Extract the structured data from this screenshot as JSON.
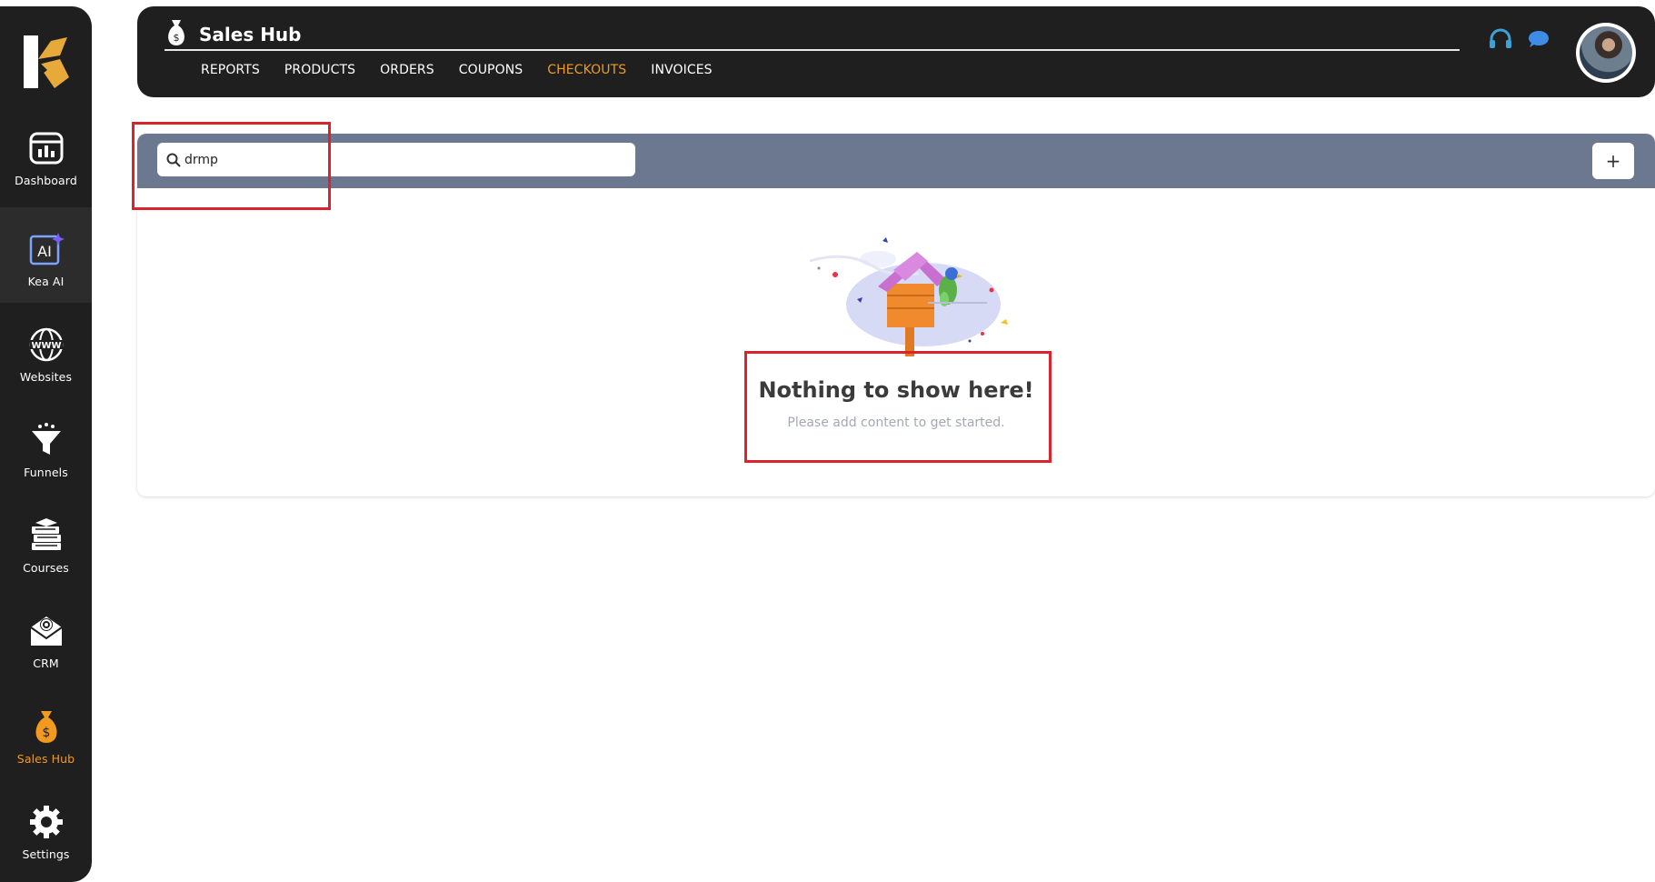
{
  "sidebar": {
    "items": [
      {
        "label": "Dashboard",
        "icon": "dashboard-icon"
      },
      {
        "label": "Kea AI",
        "icon": "ai-icon"
      },
      {
        "label": "Websites",
        "icon": "www-icon"
      },
      {
        "label": "Funnels",
        "icon": "funnel-icon"
      },
      {
        "label": "Courses",
        "icon": "books-icon"
      },
      {
        "label": "CRM",
        "icon": "mail-gear-icon"
      },
      {
        "label": "Sales Hub",
        "icon": "money-bag-icon"
      },
      {
        "label": "Settings",
        "icon": "gear-icon"
      }
    ],
    "active": "Sales Hub"
  },
  "header": {
    "title": "Sales Hub",
    "tabs": [
      "REPORTS",
      "PRODUCTS",
      "ORDERS",
      "COUPONS",
      "CHECKOUTS",
      "INVOICES"
    ],
    "active_tab": "CHECKOUTS"
  },
  "toolbar": {
    "search_value": "drmp",
    "add_label": "+"
  },
  "empty_state": {
    "title": "Nothing to show here!",
    "subtitle": "Please add content to get started."
  },
  "colors": {
    "accent": "#f29a1f",
    "sidebar_bg": "#1f1f1f",
    "toolbar_bg": "#6b7890",
    "annotation": "#d9232d"
  }
}
